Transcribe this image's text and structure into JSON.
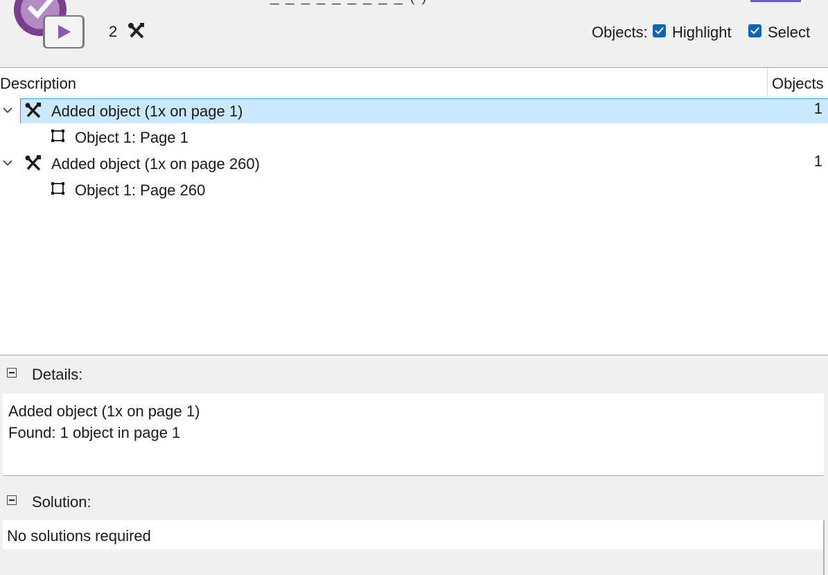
{
  "header": {
    "issue_count": "2",
    "objects_label": "Objects:",
    "highlight_label": "Highlight",
    "select_label": "Select",
    "highlight_checked": true,
    "select_checked": true
  },
  "table": {
    "columns": [
      "Description",
      "Objects"
    ],
    "rows": [
      {
        "label": "Added object (1x on page 1)",
        "count": "1",
        "selected": true,
        "child": "Object 1: Page 1"
      },
      {
        "label": "Added object (1x on page 260)",
        "count": "1",
        "selected": false,
        "child": "Object 1: Page 260"
      }
    ]
  },
  "details": {
    "title": "Details:",
    "line1": "Added object (1x on page 1)",
    "line2": "Found: 1 object in page 1"
  },
  "solution": {
    "title": "Solution:",
    "text": "No solutions required"
  },
  "colors": {
    "selection": "#cce8ff",
    "checkbox": "#1064b8"
  },
  "icons": {
    "issue": "tools-icon",
    "object": "object-frame-icon",
    "expand": "chevron-down-icon",
    "collapse": "collapse-minus-icon"
  }
}
